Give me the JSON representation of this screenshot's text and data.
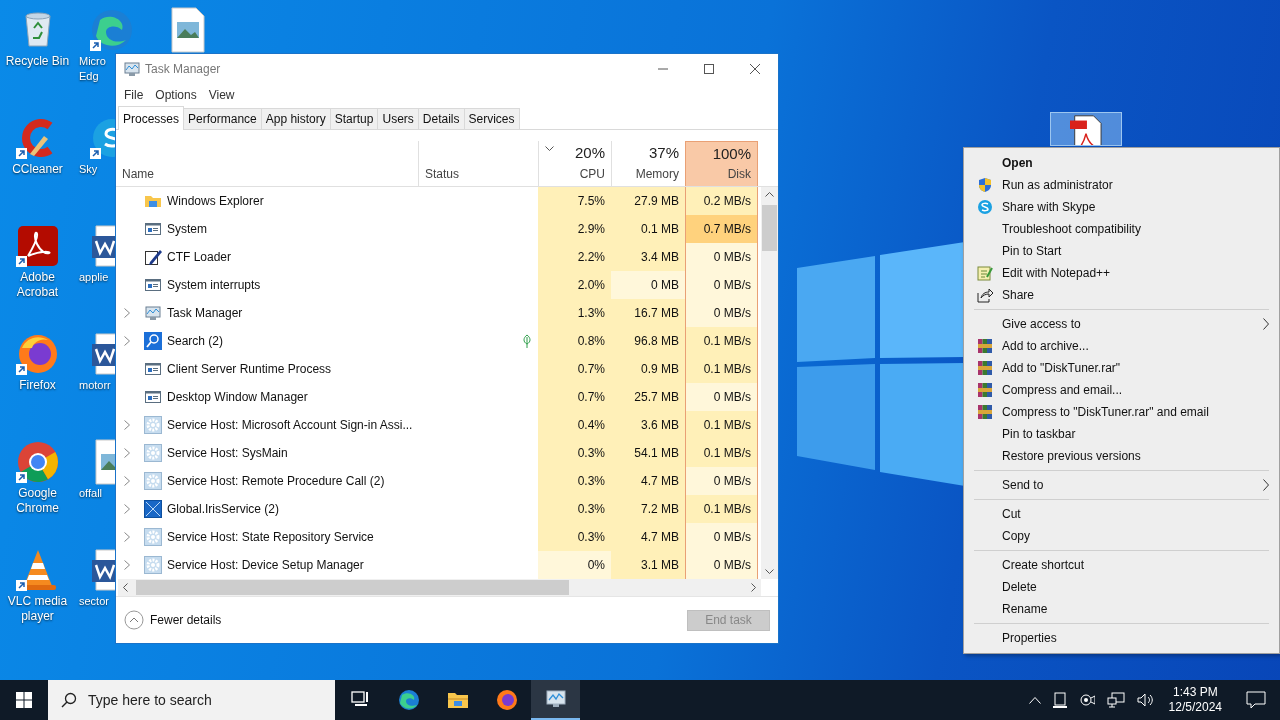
{
  "desktop": {
    "columns": [
      [
        {
          "kind": "recycle",
          "label": [
            "Recycle Bin"
          ],
          "shortcut": false
        },
        {
          "kind": "ccleaner",
          "label": [
            "CCleaner"
          ],
          "shortcut": true
        },
        {
          "kind": "acrobat",
          "label": [
            "Adobe",
            "Acrobat"
          ],
          "shortcut": true
        },
        {
          "kind": "firefox",
          "label": [
            "Firefox"
          ],
          "shortcut": true
        },
        {
          "kind": "chrome",
          "label": [
            "Google",
            "Chrome"
          ],
          "shortcut": true
        },
        {
          "kind": "vlc",
          "label": [
            "VLC media",
            "player"
          ],
          "shortcut": true
        }
      ],
      [
        {
          "kind": "edge",
          "label": [
            "Micro",
            "Edg"
          ],
          "shortcut": true
        },
        {
          "kind": "skype",
          "label": [
            "Sky"
          ],
          "shortcut": true
        },
        {
          "kind": "word",
          "label": [
            "applie"
          ],
          "shortcut": false
        },
        {
          "kind": "word",
          "label": [
            "motorr"
          ],
          "shortcut": false
        },
        {
          "kind": "image",
          "label": [
            "offall"
          ],
          "shortcut": false
        },
        {
          "kind": "word",
          "label": [
            "sector"
          ],
          "shortcut": false
        }
      ],
      [
        {
          "kind": "image",
          "shortcut": false
        }
      ]
    ],
    "selected_file": {
      "kind": "pdf",
      "selected": true
    }
  },
  "window": {
    "title": "Task Manager",
    "menu": [
      "File",
      "Options",
      "View"
    ],
    "tabs": [
      {
        "label": "Processes",
        "selected": true
      },
      {
        "label": "Performance",
        "selected": false
      },
      {
        "label": "App history",
        "selected": false
      },
      {
        "label": "Startup",
        "selected": false
      },
      {
        "label": "Users",
        "selected": false
      },
      {
        "label": "Details",
        "selected": false
      },
      {
        "label": "Services",
        "selected": false
      }
    ],
    "name_header": "Name",
    "status_header": "Status",
    "metric_headers": [
      {
        "label": "CPU",
        "total": "20%",
        "sorted": true,
        "highlighted": false
      },
      {
        "label": "Memory",
        "total": "37%",
        "sorted": false,
        "highlighted": false
      },
      {
        "label": "Disk",
        "total": "100%",
        "sorted": false,
        "highlighted": true
      }
    ],
    "processes": [
      {
        "name": "Windows Explorer",
        "kind": "folder",
        "expandable": false,
        "eco_mode": false,
        "metrics": [
          {
            "text": "7.5%",
            "color": "#fff0b8"
          },
          {
            "text": "27.9 MB",
            "color": "#fff0b8"
          },
          {
            "text": "0.2 MB/s",
            "color": "#fff0b8"
          }
        ]
      },
      {
        "name": "System",
        "kind": "window",
        "expandable": false,
        "eco_mode": false,
        "metrics": [
          {
            "text": "2.9%",
            "color": "#fff0b8"
          },
          {
            "text": "0.1 MB",
            "color": "#fff0b8"
          },
          {
            "text": "0.7 MB/s",
            "color": "#ffd27d"
          }
        ]
      },
      {
        "name": "CTF Loader",
        "kind": "pen",
        "expandable": false,
        "eco_mode": false,
        "metrics": [
          {
            "text": "2.2%",
            "color": "#fff0b8"
          },
          {
            "text": "3.4 MB",
            "color": "#fff0b8"
          },
          {
            "text": "0 MB/s",
            "color": "#fff7da"
          }
        ]
      },
      {
        "name": "System interrupts",
        "kind": "window",
        "expandable": false,
        "eco_mode": false,
        "metrics": [
          {
            "text": "2.0%",
            "color": "#fff0b8"
          },
          {
            "text": "0 MB",
            "color": "#fff7da"
          },
          {
            "text": "0 MB/s",
            "color": "#fff7da"
          }
        ]
      },
      {
        "name": "Task Manager",
        "kind": "monitor",
        "expandable": true,
        "eco_mode": false,
        "metrics": [
          {
            "text": "1.3%",
            "color": "#fff0b8"
          },
          {
            "text": "16.7 MB",
            "color": "#fff0b8"
          },
          {
            "text": "0 MB/s",
            "color": "#fff7da"
          }
        ]
      },
      {
        "name": "Search (2)",
        "kind": "search",
        "expandable": true,
        "eco_mode": true,
        "metrics": [
          {
            "text": "0.8%",
            "color": "#fff0b8"
          },
          {
            "text": "96.8 MB",
            "color": "#fff0b8"
          },
          {
            "text": "0.1 MB/s",
            "color": "#fff0b8"
          }
        ]
      },
      {
        "name": "Client Server Runtime Process",
        "kind": "window",
        "expandable": false,
        "eco_mode": false,
        "metrics": [
          {
            "text": "0.7%",
            "color": "#fff0b8"
          },
          {
            "text": "0.9 MB",
            "color": "#fff0b8"
          },
          {
            "text": "0.1 MB/s",
            "color": "#fff0b8"
          }
        ]
      },
      {
        "name": "Desktop Window Manager",
        "kind": "window",
        "expandable": false,
        "eco_mode": false,
        "metrics": [
          {
            "text": "0.7%",
            "color": "#fff0b8"
          },
          {
            "text": "25.7 MB",
            "color": "#fff0b8"
          },
          {
            "text": "0 MB/s",
            "color": "#fff7da"
          }
        ]
      },
      {
        "name": "Service Host: Microsoft Account Sign-in Assi...",
        "kind": "gear",
        "expandable": true,
        "eco_mode": false,
        "metrics": [
          {
            "text": "0.4%",
            "color": "#fff0b8"
          },
          {
            "text": "3.6 MB",
            "color": "#fff0b8"
          },
          {
            "text": "0.1 MB/s",
            "color": "#fff0b8"
          }
        ]
      },
      {
        "name": "Service Host: SysMain",
        "kind": "gear",
        "expandable": true,
        "eco_mode": false,
        "metrics": [
          {
            "text": "0.3%",
            "color": "#fff0b8"
          },
          {
            "text": "54.1 MB",
            "color": "#fff0b8"
          },
          {
            "text": "0.1 MB/s",
            "color": "#fff0b8"
          }
        ]
      },
      {
        "name": "Service Host: Remote Procedure Call (2)",
        "kind": "gear",
        "expandable": true,
        "eco_mode": false,
        "metrics": [
          {
            "text": "0.3%",
            "color": "#fff0b8"
          },
          {
            "text": "4.7 MB",
            "color": "#fff0b8"
          },
          {
            "text": "0 MB/s",
            "color": "#fff7da"
          }
        ]
      },
      {
        "name": "Global.IrisService (2)",
        "kind": "crossbox",
        "expandable": true,
        "eco_mode": false,
        "metrics": [
          {
            "text": "0.3%",
            "color": "#fff0b8"
          },
          {
            "text": "7.2 MB",
            "color": "#fff0b8"
          },
          {
            "text": "0.1 MB/s",
            "color": "#fff0b8"
          }
        ]
      },
      {
        "name": "Service Host: State Repository Service",
        "kind": "gear",
        "expandable": true,
        "eco_mode": false,
        "metrics": [
          {
            "text": "0.3%",
            "color": "#fff0b8"
          },
          {
            "text": "4.7 MB",
            "color": "#fff0b8"
          },
          {
            "text": "0 MB/s",
            "color": "#fff7da"
          }
        ]
      },
      {
        "name": "Service Host: Device Setup Manager",
        "kind": "gear",
        "expandable": true,
        "eco_mode": false,
        "metrics": [
          {
            "text": "0%",
            "color": "#fff7da"
          },
          {
            "text": "3.1 MB",
            "color": "#fff0b8"
          },
          {
            "text": "0 MB/s",
            "color": "#fff7da"
          }
        ]
      }
    ],
    "fewer_details": "Fewer details",
    "end_task": {
      "label": "End task",
      "disabled": true
    }
  },
  "context_menu": [
    {
      "kind": "plain",
      "label": "Open",
      "default": true,
      "submenu": false
    },
    {
      "kind": "shield",
      "label": "Run as administrator",
      "default": false,
      "submenu": false
    },
    {
      "kind": "chat",
      "label": "Share with Skype",
      "default": false,
      "submenu": false
    },
    {
      "kind": "plain",
      "label": "Troubleshoot compatibility",
      "default": false,
      "submenu": false
    },
    {
      "kind": "plain",
      "label": "Pin to Start",
      "default": false,
      "submenu": false
    },
    {
      "kind": "notepad",
      "label": "Edit with Notepad++",
      "default": false,
      "submenu": false
    },
    {
      "kind": "share",
      "label": "Share",
      "default": false,
      "submenu": false
    },
    {
      "kind": "separator"
    },
    {
      "kind": "plain",
      "label": "Give access to",
      "default": false,
      "submenu": true
    },
    {
      "kind": "archive",
      "label": "Add to archive...",
      "default": false,
      "submenu": false
    },
    {
      "kind": "archive",
      "label": "Add to \"DiskTuner.rar\"",
      "default": false,
      "submenu": false
    },
    {
      "kind": "archive",
      "label": "Compress and email...",
      "default": false,
      "submenu": false
    },
    {
      "kind": "archive",
      "label": "Compress to \"DiskTuner.rar\" and email",
      "default": false,
      "submenu": false
    },
    {
      "kind": "plain",
      "label": "Pin to taskbar",
      "default": false,
      "submenu": false
    },
    {
      "kind": "plain",
      "label": "Restore previous versions",
      "default": false,
      "submenu": false
    },
    {
      "kind": "separator"
    },
    {
      "kind": "plain",
      "label": "Send to",
      "default": false,
      "submenu": true
    },
    {
      "kind": "separator"
    },
    {
      "kind": "plain",
      "label": "Cut",
      "default": false,
      "submenu": false
    },
    {
      "kind": "plain",
      "label": "Copy",
      "default": false,
      "submenu": false
    },
    {
      "kind": "separator"
    },
    {
      "kind": "plain",
      "label": "Create shortcut",
      "default": false,
      "submenu": false
    },
    {
      "kind": "plain",
      "label": "Delete",
      "default": false,
      "submenu": false
    },
    {
      "kind": "plain",
      "label": "Rename",
      "default": false,
      "submenu": false
    },
    {
      "kind": "separator"
    },
    {
      "kind": "plain",
      "label": "Properties",
      "default": false,
      "submenu": false
    }
  ],
  "taskbar": {
    "search": {
      "placeholder": "Type here to search"
    },
    "apps": [
      {
        "kind": "taskview",
        "active": false
      },
      {
        "kind": "edge",
        "active": false
      },
      {
        "kind": "folder",
        "active": false
      },
      {
        "kind": "firefox",
        "active": false
      },
      {
        "kind": "monitor",
        "active": true
      }
    ],
    "time": "1:43 PM",
    "date": "12/5/2024"
  }
}
